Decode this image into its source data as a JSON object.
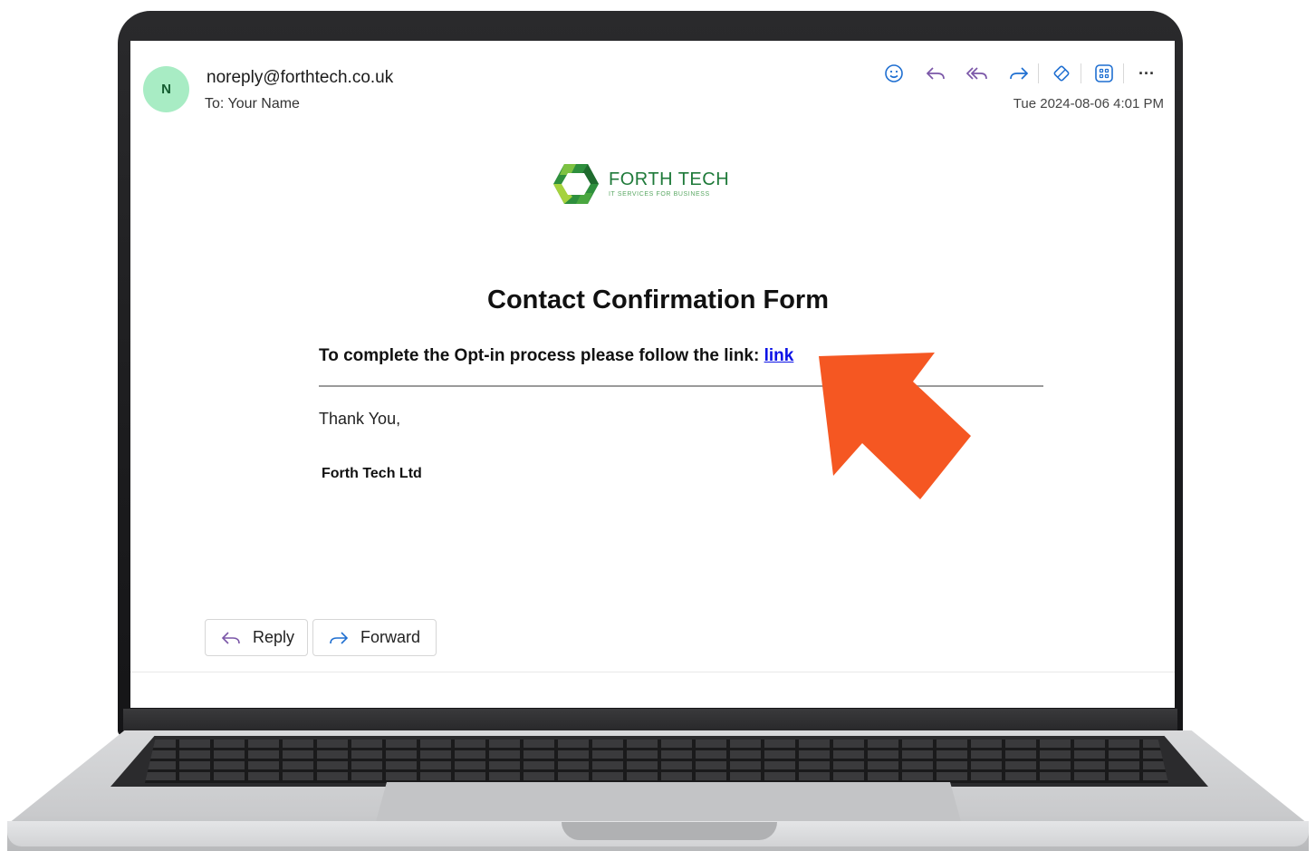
{
  "email": {
    "avatar_initial": "N",
    "sender": "noreply@forthtech.co.uk",
    "to_label": "To:",
    "to_value": "Your Name",
    "date": "Tue 2024-08-06 4:01 PM"
  },
  "toolbar": {
    "icons": [
      "emoji-icon",
      "reply-icon",
      "reply-all-icon",
      "forward-icon",
      "tag-icon",
      "apps-icon",
      "more-icon"
    ],
    "more_label": "···"
  },
  "logo": {
    "name": "FORTH TECH",
    "tagline": "IT SERVICES FOR BUSINESS"
  },
  "body": {
    "title": "Contact Confirmation Form",
    "optin_text": "To complete the Opt-in process please follow the link:",
    "link_text": "link",
    "thanks": "Thank You,",
    "signature": "Forth Tech Ltd"
  },
  "actions": {
    "reply_label": "Reply",
    "forward_label": "Forward"
  },
  "colors": {
    "accent_purple": "#7b57a8",
    "accent_blue": "#1f6fd1",
    "link_blue": "#0b12e6",
    "arrow_orange": "#f55722",
    "brand_green": "#1f7a3a"
  }
}
